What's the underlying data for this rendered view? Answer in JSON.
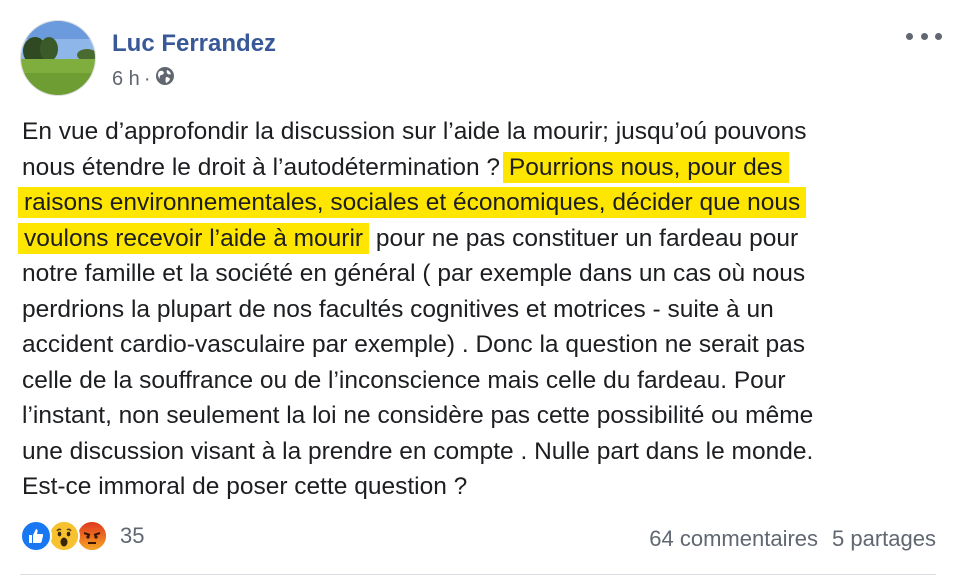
{
  "post": {
    "author": "Luc Ferrandez",
    "time": "6 h",
    "separator": "·",
    "privacy_icon": "globe-icon",
    "more_icon": "more-options-icon",
    "lines": [
      {
        "before": "En vue d’approfondir la discussion sur l’aide la mourir; jusqu’oú pouvons",
        "highlight": "",
        "after": ""
      },
      {
        "before": "nous étendre le droit à l’autodétermination ? ",
        "highlight": "Pourrions nous, pour des",
        "after": ""
      },
      {
        "before": "",
        "highlight": "raisons environnementales, sociales et économiques, décider que nous",
        "after": ""
      },
      {
        "before": "",
        "highlight": "voulons recevoir l’aide à mourir",
        "after": " pour ne pas constituer un fardeau pour"
      },
      {
        "before": "notre famille et la société en général ( par exemple dans un cas où nous",
        "highlight": "",
        "after": ""
      },
      {
        "before": "perdrions la plupart de nos facultés cognitives et motrices - suite à un",
        "highlight": "",
        "after": ""
      },
      {
        "before": "accident cardio-vasculaire par exemple) . Donc la question ne serait pas",
        "highlight": "",
        "after": ""
      },
      {
        "before": "celle de la souffrance ou de l’inconscience mais celle du fardeau. Pour",
        "highlight": "",
        "after": ""
      },
      {
        "before": "l’instant, non seulement la loi ne considère pas cette possibilité ou même",
        "highlight": "",
        "after": ""
      },
      {
        "before": "une discussion visant à la prendre en compte . Nulle part dans le monde.",
        "highlight": "",
        "after": ""
      },
      {
        "before": "Est-ce immoral de poser cette question ?",
        "highlight": "",
        "after": ""
      }
    ],
    "highlight_color": "#ffe600"
  },
  "footer": {
    "reaction_icons": [
      "like-reaction-icon",
      "wow-reaction-icon",
      "angry-reaction-icon"
    ],
    "reaction_count": "35",
    "comments": "64 commentaires",
    "shares": "5 partages"
  },
  "colors": {
    "author": "#385898",
    "meta": "#606770",
    "like": "#1877f2"
  }
}
